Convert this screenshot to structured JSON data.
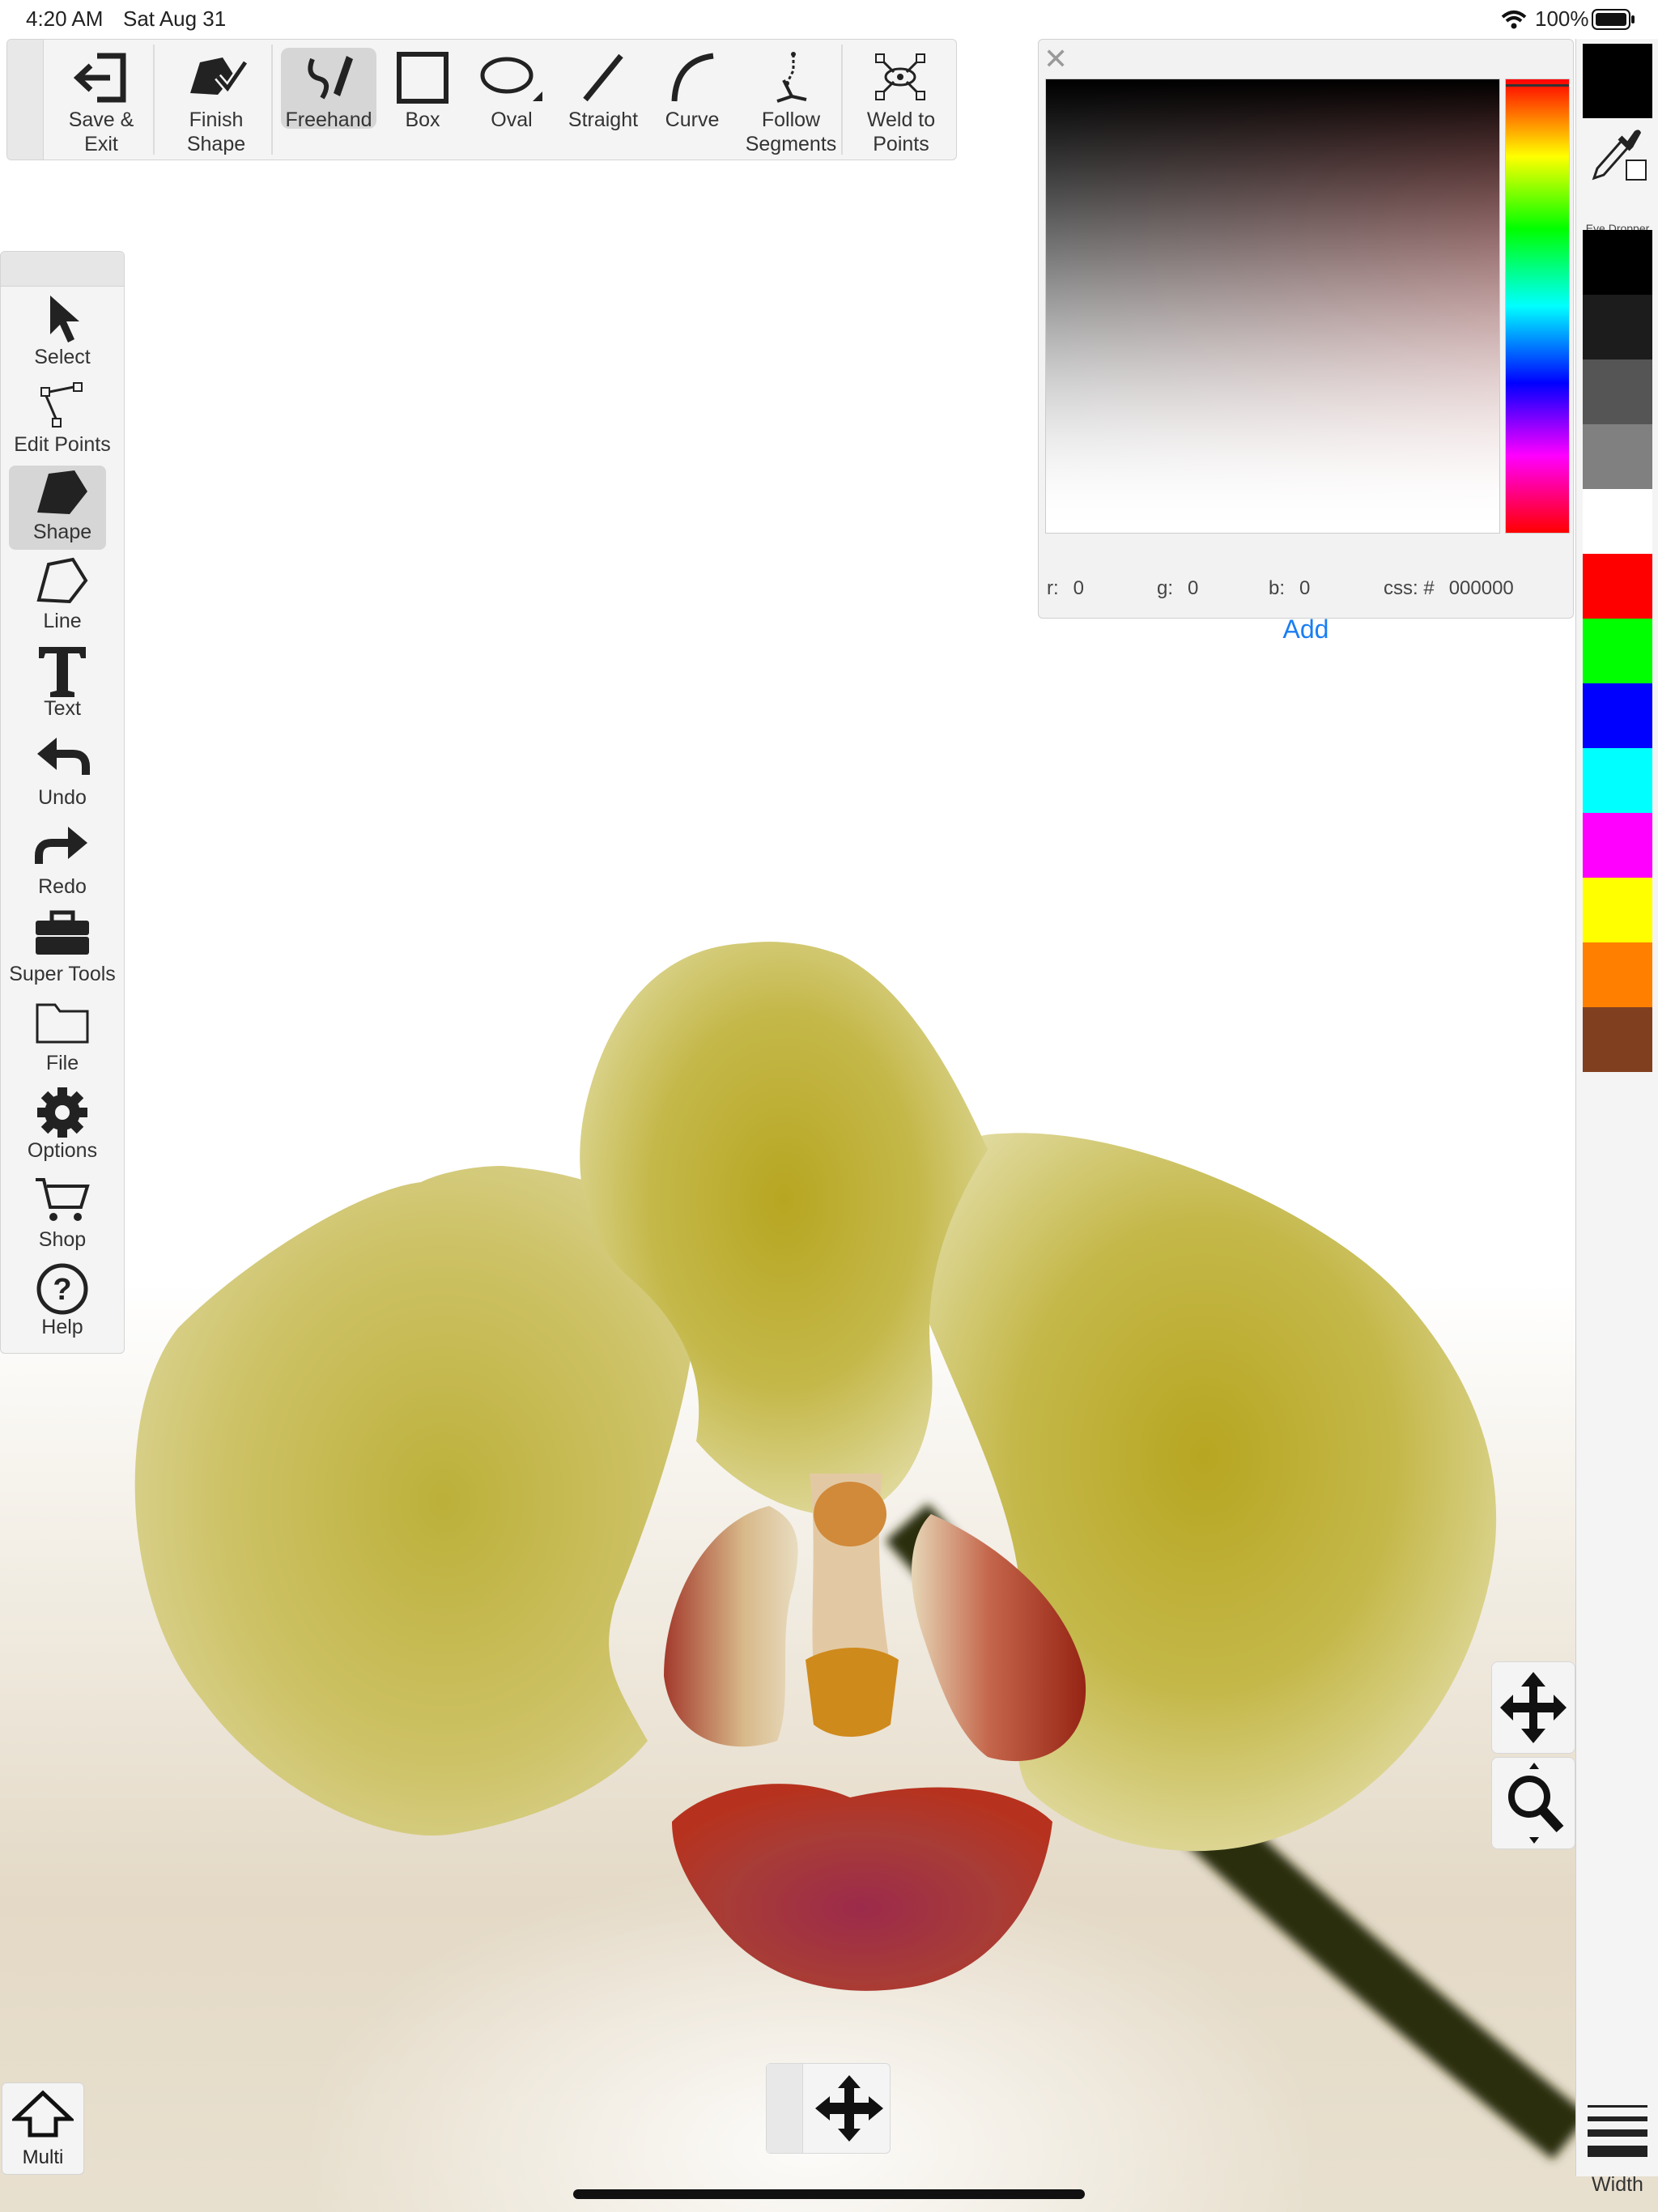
{
  "status_bar": {
    "time": "4:20 AM",
    "date": "Sat Aug 31",
    "battery": "100%"
  },
  "top_toolbar": {
    "save_exit": "Save &\nExit",
    "finish_shape": "Finish\nShape",
    "freehand": "Freehand",
    "box": "Box",
    "oval": "Oval",
    "straight": "Straight",
    "curve": "Curve",
    "follow_segments": "Follow\nSegments",
    "weld_to_points": "Weld to\nPoints"
  },
  "left_toolbar": {
    "select": "Select",
    "edit_points": "Edit Points",
    "shape": "Shape",
    "line": "Line",
    "text": "Text",
    "undo": "Undo",
    "redo": "Redo",
    "super_tools": "Super Tools",
    "file": "File",
    "options": "Options",
    "shop": "Shop",
    "help": "Help"
  },
  "color_picker": {
    "close": "✕",
    "r_label": "r:",
    "r_value": "0",
    "g_label": "g:",
    "g_value": "0",
    "b_label": "b:",
    "b_value": "0",
    "css_label": "css: #",
    "css_value": "000000",
    "add": "Add"
  },
  "palette": {
    "current": "#000000",
    "eye_dropper": "Eye Dropper",
    "swatches": [
      "#000000",
      "#1c1c1c",
      "#555555",
      "#808080",
      "#ffffff",
      "#ff0000",
      "#00ff00",
      "#0000ff",
      "#00ffff",
      "#ff00ff",
      "#ffff00",
      "#ff8000",
      "#804020"
    ],
    "width": "Width"
  },
  "bottom": {
    "multi": "Multi"
  },
  "colors": {
    "accent": "#1a7ef2",
    "toolbar_bg": "#f4f4f4",
    "petal": "#c9bd3e",
    "lip": "#a3302a"
  }
}
